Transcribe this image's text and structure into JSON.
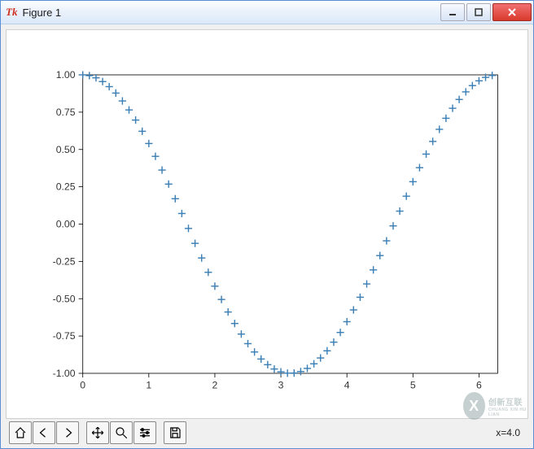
{
  "window": {
    "title": "Figure 1",
    "tk_mark": "Tk"
  },
  "status_text": "x=4.0",
  "watermark": {
    "line1": "创新互联",
    "line2": "CHUANG XIN HU LIAN"
  },
  "toolbar": {
    "icons": [
      "home",
      "back",
      "forward",
      "pan",
      "zoom",
      "configure",
      "save"
    ]
  },
  "chart_data": {
    "type": "scatter",
    "marker": "+",
    "xlabel": "",
    "ylabel": "",
    "title": "",
    "xlim": [
      0,
      6.283
    ],
    "ylim": [
      -1.0,
      1.0
    ],
    "xticks": [
      0,
      1,
      2,
      3,
      4,
      5,
      6
    ],
    "yticks": [
      -1.0,
      -0.75,
      -0.5,
      -0.25,
      0.0,
      0.25,
      0.5,
      0.75,
      1.0
    ],
    "x": [
      0,
      0.1,
      0.2,
      0.3,
      0.4,
      0.5,
      0.6,
      0.7,
      0.8,
      0.9,
      1.0,
      1.1,
      1.2,
      1.3,
      1.4,
      1.5,
      1.6,
      1.7,
      1.8,
      1.9,
      2.0,
      2.1,
      2.2,
      2.3,
      2.4,
      2.5,
      2.6,
      2.7,
      2.8,
      2.9,
      3.0,
      3.1,
      3.2,
      3.3,
      3.4,
      3.5,
      3.6,
      3.7,
      3.8,
      3.9,
      4.0,
      4.1,
      4.2,
      4.3,
      4.4,
      4.5,
      4.6,
      4.7,
      4.8,
      4.9,
      5.0,
      5.1,
      5.2,
      5.3,
      5.4,
      5.5,
      5.6,
      5.7,
      5.8,
      5.9,
      6.0,
      6.1,
      6.2
    ],
    "y": [
      1.0,
      0.995,
      0.98,
      0.955,
      0.921,
      0.878,
      0.825,
      0.765,
      0.697,
      0.622,
      0.54,
      0.454,
      0.362,
      0.268,
      0.17,
      0.071,
      -0.029,
      -0.129,
      -0.227,
      -0.323,
      -0.416,
      -0.505,
      -0.589,
      -0.666,
      -0.737,
      -0.801,
      -0.857,
      -0.904,
      -0.942,
      -0.971,
      -0.99,
      -0.999,
      -0.998,
      -0.988,
      -0.967,
      -0.936,
      -0.897,
      -0.849,
      -0.791,
      -0.726,
      -0.654,
      -0.575,
      -0.49,
      -0.401,
      -0.307,
      -0.211,
      -0.112,
      -0.012,
      0.087,
      0.187,
      0.284,
      0.378,
      0.469,
      0.554,
      0.635,
      0.709,
      0.776,
      0.835,
      0.886,
      0.928,
      0.96,
      0.983,
      0.996
    ]
  }
}
